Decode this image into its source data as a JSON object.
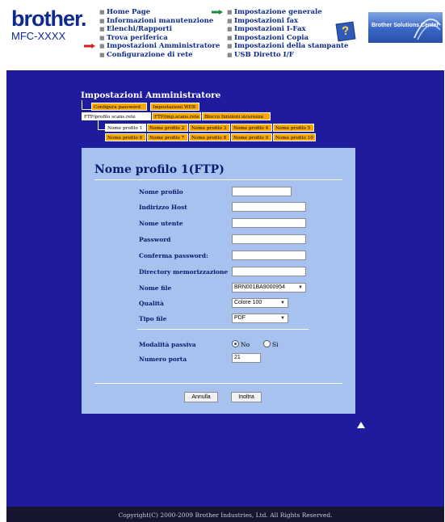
{
  "header": {
    "logo": "brother.",
    "model": "MFC-XXXX",
    "nav_left": [
      {
        "label": "Home Page",
        "active": false
      },
      {
        "label": "Informazioni manutenzione",
        "active": false
      },
      {
        "label": "Elenchi/Rapporti",
        "active": false
      },
      {
        "label": "Trova periferica",
        "active": false
      },
      {
        "label": "Impostazioni Amministratore",
        "active": true
      },
      {
        "label": "Configurazione di rete",
        "active": false
      }
    ],
    "nav_right": [
      {
        "label": "Impostazione generale"
      },
      {
        "label": "Impostazioni fax"
      },
      {
        "label": "Impostazioni I-Fax"
      },
      {
        "label": "Impostazioni Copia"
      },
      {
        "label": "Impostazioni della stampante"
      },
      {
        "label": "USB Diretto I/F"
      }
    ],
    "help_icon": "?",
    "solutions_banner": "Brother Solutions Center"
  },
  "section_title": "Impostazioni Amministratore",
  "tabs_row1": [
    "Configura password",
    "Impostazioni WEB"
  ],
  "tabs_row2": [
    "FTP/profilo scans.rete",
    "FTP/imp.scans.rete",
    "Blocco funzioni sicurezza"
  ],
  "profile_tabs_row1": [
    "Nome profilo 1",
    "Nome profilo 2",
    "Nome profilo 3",
    "Nome profilo 4",
    "Nome profilo 5"
  ],
  "profile_tabs_row2": [
    "Nome profilo 6",
    "Nome profilo 7",
    "Nome profilo 8",
    "Nome profilo 9",
    "Nome profilo 10"
  ],
  "form": {
    "title": "Nome profilo 1(FTP)",
    "labels": {
      "profile_name": "Nome profilo",
      "host": "Indirizzo Host",
      "user": "Nome utente",
      "password": "Password",
      "confirm": "Conferma password:",
      "directory": "Directory memorizzazione",
      "file_name": "Nome file",
      "quality": "Qualità",
      "file_type": "Tipo file",
      "passive": "Modalità passiva",
      "port": "Numero porta"
    },
    "values": {
      "file_name": "BRN001BA9000954",
      "quality": "Colore 100",
      "file_type": "PDF",
      "port": "21"
    },
    "passive_options": [
      "No",
      "Sì"
    ],
    "passive_selected": "No",
    "cancel": "Annulla",
    "submit": "Inoltra"
  },
  "footer": "Copyright(C) 2000-2009 Brother Industries, Ltd. All Rights Reserved.",
  "colors": {
    "background": "#1e1b9c",
    "tab_orange": "#f8a900",
    "panel": "#a7c2ee",
    "text_navy": "#0d1a6d"
  }
}
